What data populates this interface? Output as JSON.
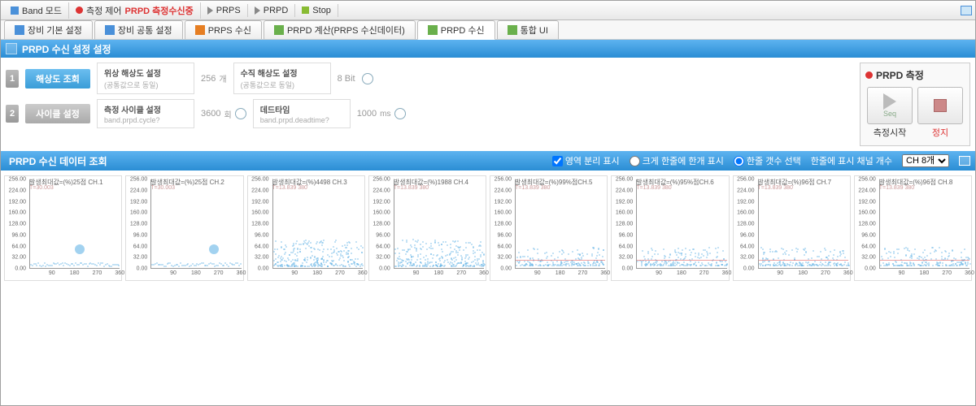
{
  "toolbar": {
    "band_mode": "Band 모드",
    "measure_ctrl": "측정 제어",
    "status": "PRPD 측정수신중",
    "prps": "PRPS",
    "prpd": "PRPD",
    "stop": "Stop"
  },
  "tabs": [
    {
      "label": "장비 기본 설정"
    },
    {
      "label": "장비 공통 설정"
    },
    {
      "label": "PRPS 수신"
    },
    {
      "label": "PRPD 계산(PRPS 수신데이터)"
    },
    {
      "label": "PRPD 수신"
    },
    {
      "label": "통합 UI"
    }
  ],
  "active_tab": 4,
  "section1_title": "PRPD 수신 설정 설정",
  "settings": {
    "row1": {
      "num": "1",
      "label": "해상도 조회"
    },
    "row2": {
      "num": "2",
      "label": "사이클 설정"
    },
    "phase_res": {
      "label": "위상 해상도 설정",
      "sub": "(공통값으로 동일)",
      "value": "256",
      "unit": "개"
    },
    "vert_res": {
      "label": "수직 해상도 설정",
      "sub": "(공통값으로 동일)",
      "value": "8 Bit"
    },
    "cycle": {
      "label": "측정 사이클 설정",
      "sub": "band.prpd.cycle?",
      "value": "3600",
      "unit": "회"
    },
    "deadtime": {
      "label": "데드타임",
      "sub": "band.prpd.deadtime?",
      "value": "1000",
      "unit": "ms"
    }
  },
  "measure": {
    "title": "PRPD 측정",
    "start_sub": "Seq",
    "start": "측정시작",
    "stop": "정지"
  },
  "data_section": {
    "title": "PRPD 수신 데이터 조회",
    "chk_split": "영역 분리 표시",
    "radio_big": "크게 한줄에 한개 표시",
    "radio_row": "한줄 갯수 선택",
    "row_count_label": "한줄에 표시 채널 개수",
    "select_value": "CH 8개"
  },
  "chart_data": [
    {
      "type": "scatter",
      "title": "발생최대값=(%)25점 CH.1",
      "subtitle": "T=30.003",
      "ylim": [
        0,
        256
      ],
      "xlim": [
        0,
        360
      ],
      "y_ticks": [
        0,
        32,
        64,
        96,
        128,
        160,
        192,
        224,
        256
      ],
      "x_ticks": [
        90,
        180,
        270,
        360
      ],
      "pattern": "blob",
      "blob_x": 180,
      "blob_y": 40
    },
    {
      "type": "scatter",
      "title": "발생최대값=(%)25점 CH.2",
      "subtitle": "T=30.003",
      "ylim": [
        0,
        256
      ],
      "xlim": [
        0,
        360
      ],
      "y_ticks": [
        0,
        32,
        64,
        96,
        128,
        160,
        192,
        224,
        256
      ],
      "x_ticks": [
        90,
        180,
        270,
        360
      ],
      "pattern": "blob",
      "blob_x": 230,
      "blob_y": 40
    },
    {
      "type": "scatter",
      "title": "발생최대값=(%)4498 CH.3",
      "subtitle": "T=13.839 380",
      "ylim": [
        0,
        256
      ],
      "xlim": [
        0,
        360
      ],
      "y_ticks": [
        0,
        32,
        64,
        96,
        128,
        160,
        192,
        224,
        256
      ],
      "x_ticks": [
        90,
        180,
        270,
        360
      ],
      "pattern": "dense"
    },
    {
      "type": "scatter",
      "title": "발생최대값=(%)1988 CH.4",
      "subtitle": "T=13.839 380",
      "ylim": [
        0,
        256
      ],
      "xlim": [
        0,
        360
      ],
      "y_ticks": [
        0,
        32,
        64,
        96,
        128,
        160,
        192,
        224,
        256
      ],
      "x_ticks": [
        90,
        180,
        270,
        360
      ],
      "pattern": "dense"
    },
    {
      "type": "scatter",
      "title": "발생최대값=(%)99%점CH.5",
      "subtitle": "T=13.839 380",
      "ylim": [
        0,
        256
      ],
      "xlim": [
        0,
        360
      ],
      "y_ticks": [
        0,
        32,
        64,
        96,
        128,
        160,
        192,
        224,
        256
      ],
      "x_ticks": [
        90,
        180,
        270,
        360
      ],
      "pattern": "band"
    },
    {
      "type": "scatter",
      "title": "발생최대값=(%)95%점CH.6",
      "subtitle": "T=13.839 380",
      "ylim": [
        0,
        256
      ],
      "xlim": [
        0,
        360
      ],
      "y_ticks": [
        0,
        32,
        64,
        96,
        128,
        160,
        192,
        224,
        256
      ],
      "x_ticks": [
        90,
        180,
        270,
        360
      ],
      "pattern": "band"
    },
    {
      "type": "scatter",
      "title": "발생최대값=(%)96점 CH.7",
      "subtitle": "T=13.839 380",
      "ylim": [
        0,
        256
      ],
      "xlim": [
        0,
        360
      ],
      "y_ticks": [
        0,
        32,
        64,
        96,
        128,
        160,
        192,
        224,
        256
      ],
      "x_ticks": [
        90,
        180,
        270,
        360
      ],
      "pattern": "band"
    },
    {
      "type": "scatter",
      "title": "발생최대값=(%)96점 CH.8",
      "subtitle": "T=13.839 380",
      "ylim": [
        0,
        256
      ],
      "xlim": [
        0,
        360
      ],
      "y_ticks": [
        0,
        32,
        64,
        96,
        128,
        160,
        192,
        224,
        256
      ],
      "x_ticks": [
        90,
        180,
        270,
        360
      ],
      "pattern": "band"
    }
  ]
}
